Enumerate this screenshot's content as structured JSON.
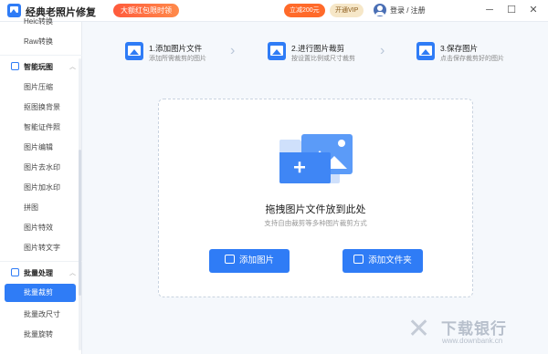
{
  "app": {
    "title": "经典老照片修复",
    "promo": "大额红包限时领",
    "coupon": "立减200元",
    "vip": "开通VIP",
    "login": "登录 / 注册",
    "window_controls": [
      "minimize-icon",
      "restore-icon",
      "close-icon"
    ]
  },
  "sidebar": {
    "top_items": [
      "Heic转换",
      "Raw转换"
    ],
    "group_smart": {
      "label": "智能玩图",
      "items": [
        "图片压缩",
        "抠图换背景",
        "智能证件照",
        "图片编辑",
        "图片去水印",
        "图片加水印",
        "拼图",
        "图片特效",
        "图片转文字"
      ]
    },
    "group_batch": {
      "label": "批量处理",
      "active_item": "批量裁剪",
      "items": [
        "批量改尺寸",
        "批量旋转"
      ]
    }
  },
  "steps": [
    {
      "title": "1.添加图片文件",
      "desc": "添加所需裁剪的图片"
    },
    {
      "title": "2.进行图片裁剪",
      "desc": "按设置比例或尺寸裁剪"
    },
    {
      "title": "3.保存图片",
      "desc": "点击保存裁剪好的图片"
    }
  ],
  "dropzone": {
    "title": "拖拽图片文件放到此处",
    "subtitle": "支持自由裁剪等多种图片裁剪方式",
    "add_image_label": "添加图片",
    "add_folder_label": "添加文件夹"
  },
  "watermark": {
    "name": "下载银行",
    "url": "www.downbank.cn"
  },
  "colors": {
    "accent": "#2f7cf6",
    "promo": "#ff5a3c",
    "vip": "#f6e7c8"
  }
}
